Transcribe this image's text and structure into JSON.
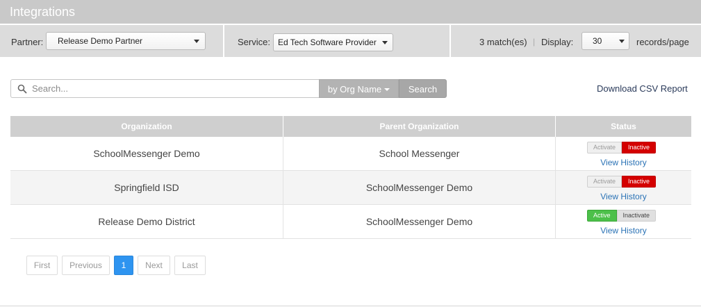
{
  "header": {
    "title": "Integrations"
  },
  "filters": {
    "partner_label": "Partner:",
    "partner_value": "Release Demo Partner",
    "service_label": "Service:",
    "service_value": "Ed Tech Software Provider",
    "matches": "3 match(es)",
    "separator": "|",
    "display_label": "Display:",
    "display_value": "30",
    "records_label": "records/page"
  },
  "search": {
    "placeholder": "Search...",
    "by_label": "by Org Name",
    "button_label": "Search",
    "csv_link": "Download CSV Report"
  },
  "table": {
    "headers": [
      "Organization",
      "Parent Organization",
      "Status"
    ],
    "rows": [
      {
        "organization": "SchoolMessenger Demo",
        "parent": "School Messenger",
        "left_label": "Activate",
        "right_label": "Inactive",
        "state": "inactive",
        "history": "View History"
      },
      {
        "organization": "Springfield ISD",
        "parent": "SchoolMessenger Demo",
        "left_label": "Activate",
        "right_label": "Inactive",
        "state": "inactive",
        "history": "View History"
      },
      {
        "organization": "Release Demo District",
        "parent": "SchoolMessenger Demo",
        "left_label": "Active",
        "right_label": "Inactivate",
        "state": "active",
        "history": "View History"
      }
    ]
  },
  "pagination": {
    "first": "First",
    "previous": "Previous",
    "current": "1",
    "next": "Next",
    "last": "Last"
  },
  "colors": {
    "active": "#4cc04a",
    "inactive": "#d40000",
    "link": "#2a72b5",
    "current_page": "#2e94f0"
  }
}
